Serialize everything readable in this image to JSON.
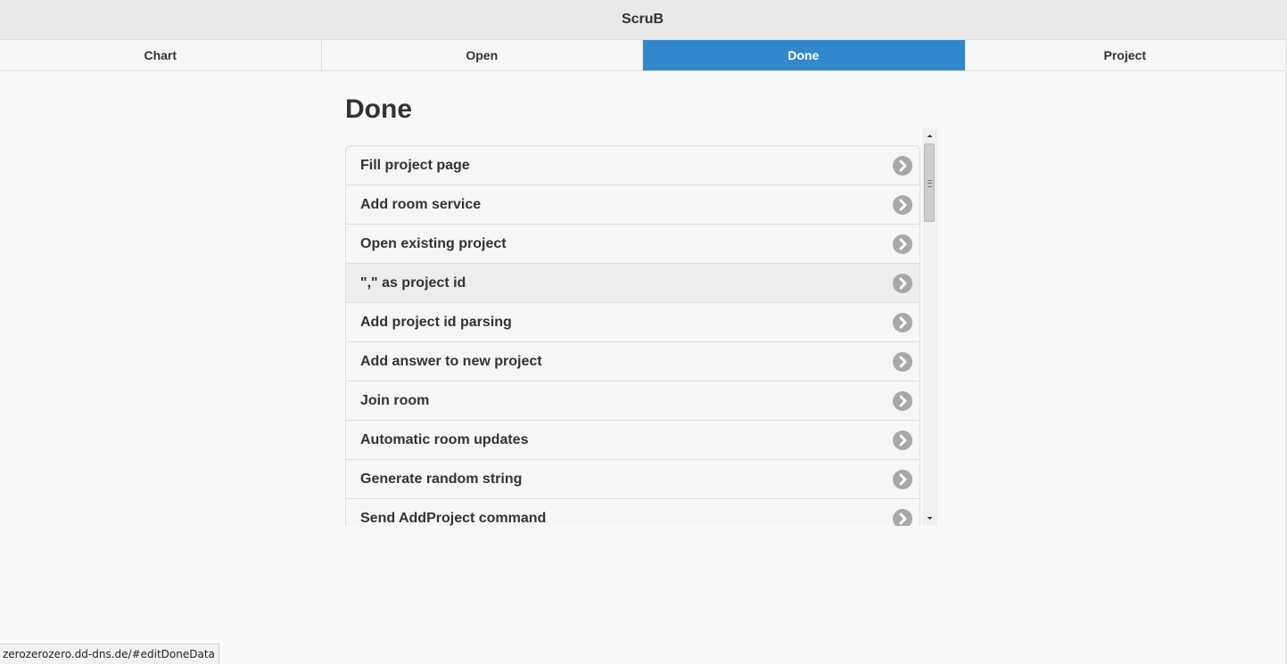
{
  "app": {
    "title": "ScruB"
  },
  "nav": {
    "tabs": [
      {
        "label": "Chart",
        "active": false
      },
      {
        "label": "Open",
        "active": false
      },
      {
        "label": "Done",
        "active": true
      },
      {
        "label": "Project",
        "active": false
      }
    ]
  },
  "main": {
    "heading": "Done",
    "items": [
      {
        "label": "Fill project page",
        "icon": "chevron-right-icon"
      },
      {
        "label": "Add room service",
        "icon": "chevron-right-icon"
      },
      {
        "label": "Open existing project",
        "icon": "chevron-right-icon"
      },
      {
        "label": "\",\" as project id",
        "icon": "chevron-right-icon"
      },
      {
        "label": "Add project id parsing",
        "icon": "chevron-right-icon"
      },
      {
        "label": "Add answer to new project",
        "icon": "chevron-right-icon"
      },
      {
        "label": "Join room",
        "icon": "chevron-right-icon"
      },
      {
        "label": "Automatic room updates",
        "icon": "chevron-right-icon"
      },
      {
        "label": "Generate random string",
        "icon": "chevron-right-icon"
      },
      {
        "label": "Send AddProject command",
        "icon": "chevron-right-icon"
      }
    ]
  },
  "status": {
    "url": "zerozerozero.dd-dns.de/#editDoneData"
  },
  "colors": {
    "accent": "#3388cc",
    "header_bg": "#e9e9e9",
    "list_bg": "#f6f6f6",
    "icon_bg": "#a8a8a8"
  }
}
